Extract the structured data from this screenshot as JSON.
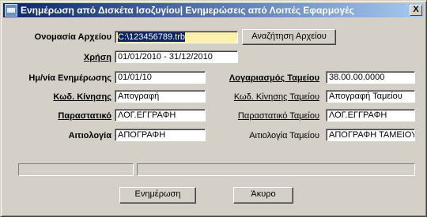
{
  "window": {
    "title": "Ενημέρωση από Δισκέτα Ισοζυγίου| Ενημερώσεις από Λοιπές Εφαρμογές",
    "close_label": "X"
  },
  "form": {
    "file_name_label": "Ονομασία Αρχείου",
    "file_name_value": "C:\\123456789.trb",
    "browse_button": "Αναζήτηση Αρχείου",
    "year_label": "Χρήση",
    "year_value": "01/01/2010 - 31/12/2010",
    "update_date_label": "Ημ/νία Ενημέρωσης",
    "update_date_value": "01/01/10",
    "cash_account_label": "Λογαριασμός Ταμείου",
    "cash_account_value": "38.00.00.0000",
    "movement_code_label": "Κωδ. Κίνησης",
    "movement_code_value": "Απογραφή",
    "cash_movement_code_label": "Κωδ. Κίνησης Ταμείου",
    "cash_movement_code_value": "Απογραφή Ταμείου",
    "document_label": "Παραστατικό",
    "document_value": "ΛΟΓ.ΕΓΓΡΑΦΗ",
    "cash_document_label": "Παραστατικό Ταμείου",
    "cash_document_value": "ΛΟΓ.ΕΓΓΡΑΦΗ",
    "reason_label": "Αιτιολογία",
    "reason_value": "ΑΠΟΓΡΑΦΗ",
    "cash_reason_label": "Αιτιολογία Ταμείου",
    "cash_reason_value": "ΑΠΟΓΡΑΦΗ ΤΑΜΕΙΟΥ"
  },
  "footer": {
    "update_button": "Ενημέρωση",
    "cancel_button": "Άκυρο"
  }
}
